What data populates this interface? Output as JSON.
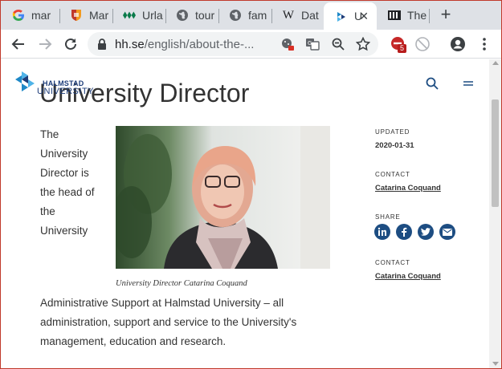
{
  "tabs": [
    {
      "label": "mar",
      "icon": "google-icon"
    },
    {
      "label": "Mar",
      "icon": "shield-crest-icon"
    },
    {
      "label": "Urla",
      "icon": "diamonds-icon"
    },
    {
      "label": "tour",
      "icon": "globe-icon"
    },
    {
      "label": "fam",
      "icon": "globe-icon"
    },
    {
      "label": "Dat",
      "icon": "wikipedia-icon"
    },
    {
      "label": "U",
      "icon": "halmstad-icon",
      "active": true
    },
    {
      "label": "The",
      "icon": "film-icon"
    }
  ],
  "toolbar": {
    "url_host": "hh.se",
    "url_path": "/english/about-the-...",
    "extension_badge": "5"
  },
  "site": {
    "logo_line1": "HALMSTAD",
    "logo_line2": "UNIVERSITY",
    "brand_color": "#1d3d7a",
    "accent_color": "#1d4d82"
  },
  "article": {
    "title": "University Director",
    "intro": "The University Director is the head of the University",
    "caption": "University Director Catarina Coquand",
    "body": "Administrative Support at Halmstad University – all administration, support and service to the University's management, education and research."
  },
  "sidebar": {
    "updated_label": "UPDATED",
    "updated_value": "2020-01-31",
    "contact_label": "CONTACT",
    "contact_name": "Catarina Coquand",
    "share_label": "SHARE",
    "share_icons": [
      "linkedin-icon",
      "facebook-icon",
      "twitter-icon",
      "email-icon"
    ],
    "contact2_label": "CONTACT",
    "contact2_name": "Catarina Coquand"
  }
}
